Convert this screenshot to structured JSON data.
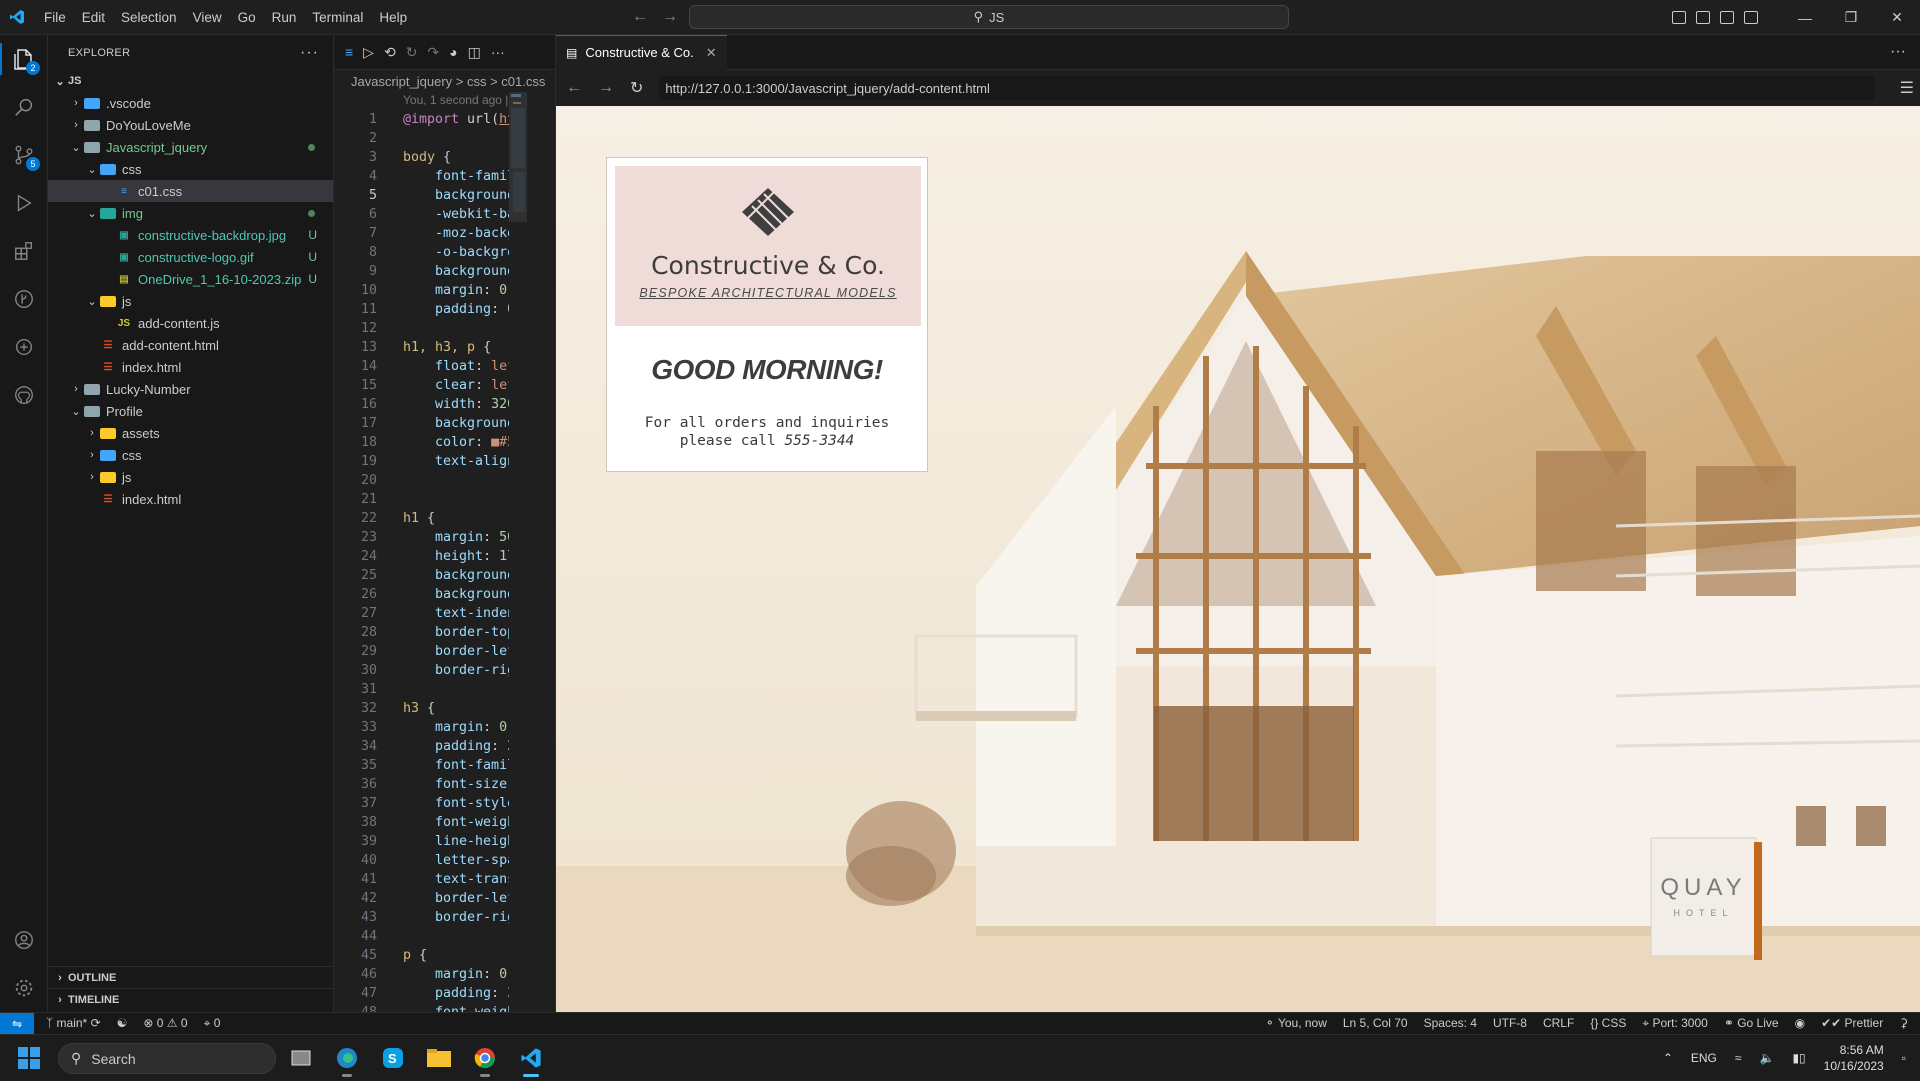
{
  "titlebar": {
    "menu": [
      "File",
      "Edit",
      "Selection",
      "View",
      "Go",
      "Run",
      "Terminal",
      "Help"
    ],
    "search_text": "JS"
  },
  "activity": {
    "explorer_badge": "2",
    "scm_badge": "5"
  },
  "explorer": {
    "title": "EXPLORER",
    "root": "JS",
    "items": [
      {
        "label": ".vscode",
        "depth": 1,
        "type": "folder-blue",
        "open": false
      },
      {
        "label": "DoYouLoveMe",
        "depth": 1,
        "type": "folder",
        "open": false
      },
      {
        "label": "Javascript_jquery",
        "depth": 1,
        "type": "folder",
        "open": true,
        "color": "green",
        "status": "dot"
      },
      {
        "label": "css",
        "depth": 2,
        "type": "folder-blue",
        "open": true
      },
      {
        "label": "c01.css",
        "depth": 3,
        "type": "css",
        "selected": true
      },
      {
        "label": "img",
        "depth": 2,
        "type": "folder-teal",
        "open": true,
        "color": "green",
        "status": "dot"
      },
      {
        "label": "constructive-backdrop.jpg",
        "depth": 3,
        "type": "img",
        "color": "green",
        "status": "U"
      },
      {
        "label": "constructive-logo.gif",
        "depth": 3,
        "type": "img",
        "color": "green",
        "status": "U"
      },
      {
        "label": "OneDrive_1_16-10-2023.zip",
        "depth": 3,
        "type": "zip",
        "color": "green",
        "status": "U"
      },
      {
        "label": "js",
        "depth": 2,
        "type": "folder-yellow",
        "open": true
      },
      {
        "label": "add-content.js",
        "depth": 3,
        "type": "js"
      },
      {
        "label": "add-content.html",
        "depth": 2,
        "type": "html"
      },
      {
        "label": "index.html",
        "depth": 2,
        "type": "html"
      },
      {
        "label": "Lucky-Number",
        "depth": 1,
        "type": "folder",
        "open": false
      },
      {
        "label": "Profile",
        "depth": 1,
        "type": "folder",
        "open": true
      },
      {
        "label": "assets",
        "depth": 2,
        "type": "folder-yellow",
        "open": false
      },
      {
        "label": "css",
        "depth": 2,
        "type": "folder-blue",
        "open": false
      },
      {
        "label": "js",
        "depth": 2,
        "type": "folder-yellow",
        "open": false
      },
      {
        "label": "index.html",
        "depth": 2,
        "type": "html"
      }
    ],
    "outline": "OUTLINE",
    "timeline": "TIMELINE"
  },
  "editor": {
    "breadcrumb": "Javascript_jquery > css > c01.css",
    "blame": "You, 1 second ago | 1",
    "lines": [
      [
        [
          "kw",
          "@import"
        ],
        [
          "pun",
          " url("
        ],
        [
          "url",
          "htt"
        ]
      ],
      [],
      [
        [
          "sel-k",
          "body"
        ],
        [
          "pun",
          " {"
        ]
      ],
      [
        [
          "prop",
          "    font-family"
        ]
      ],
      [
        [
          "prop",
          "    background:"
        ]
      ],
      [
        [
          "prop",
          "    -webkit-bac"
        ]
      ],
      [
        [
          "prop",
          "    -moz-backgr"
        ]
      ],
      [
        [
          "prop",
          "    -o-backgrou"
        ]
      ],
      [
        [
          "prop",
          "    background-"
        ]
      ],
      [
        [
          "prop",
          "    margin"
        ],
        [
          "pun",
          ": "
        ],
        [
          "num",
          "0"
        ],
        [
          "pun",
          ";"
        ]
      ],
      [
        [
          "prop",
          "    padding"
        ],
        [
          "pun",
          ": "
        ],
        [
          "num",
          "0"
        ],
        [
          "pun",
          ";"
        ]
      ],
      [],
      [
        [
          "sel-k",
          "h1, h3, p"
        ],
        [
          "pun",
          " {"
        ]
      ],
      [
        [
          "prop",
          "    float"
        ],
        [
          "pun",
          ": "
        ],
        [
          "val",
          "left"
        ]
      ],
      [
        [
          "prop",
          "    clear"
        ],
        [
          "pun",
          ": "
        ],
        [
          "val",
          "left"
        ]
      ],
      [
        [
          "prop",
          "    width"
        ],
        [
          "pun",
          ": "
        ],
        [
          "num",
          "320p"
        ]
      ],
      [
        [
          "prop",
          "    background-"
        ]
      ],
      [
        [
          "prop",
          "    color"
        ],
        [
          "pun",
          ": "
        ],
        [
          "val",
          "■#5"
        ]
      ],
      [
        [
          "prop",
          "    text-align:"
        ]
      ],
      [],
      [],
      [
        [
          "sel-k",
          "h1"
        ],
        [
          "pun",
          " {"
        ]
      ],
      [
        [
          "prop",
          "    margin"
        ],
        [
          "pun",
          ": "
        ],
        [
          "num",
          "50p"
        ]
      ],
      [
        [
          "prop",
          "    height"
        ],
        [
          "pun",
          ": "
        ],
        [
          "num",
          "175"
        ]
      ],
      [
        [
          "prop",
          "    background-"
        ]
      ],
      [
        [
          "prop",
          "    background-"
        ]
      ],
      [
        [
          "prop",
          "    text-indent"
        ]
      ],
      [
        [
          "prop",
          "    border-top:"
        ]
      ],
      [
        [
          "prop",
          "    border-left"
        ]
      ],
      [
        [
          "prop",
          "    border-righ"
        ]
      ],
      [],
      [
        [
          "sel-k",
          "h3"
        ],
        [
          "pun",
          " {"
        ]
      ],
      [
        [
          "prop",
          "    margin"
        ],
        [
          "pun",
          ": "
        ],
        [
          "num",
          "0 0"
        ]
      ],
      [
        [
          "prop",
          "    padding"
        ],
        [
          "pun",
          ": "
        ],
        [
          "num",
          "25"
        ]
      ],
      [
        [
          "prop",
          "    font-family"
        ]
      ],
      [
        [
          "prop",
          "    font-size:"
        ]
      ],
      [
        [
          "prop",
          "    font-style:"
        ]
      ],
      [
        [
          "prop",
          "    font-weight"
        ]
      ],
      [
        [
          "prop",
          "    line-height"
        ]
      ],
      [
        [
          "prop",
          "    letter-spac"
        ]
      ],
      [
        [
          "prop",
          "    text-transf"
        ]
      ],
      [
        [
          "prop",
          "    border-left"
        ]
      ],
      [
        [
          "prop",
          "    border-righ"
        ]
      ],
      [],
      [
        [
          "sel-k",
          "p"
        ],
        [
          "pun",
          " {"
        ]
      ],
      [
        [
          "prop",
          "    margin"
        ],
        [
          "pun",
          ": "
        ],
        [
          "num",
          "0 0"
        ]
      ],
      [
        [
          "prop",
          "    padding"
        ],
        [
          "pun",
          ": "
        ],
        [
          "num",
          "30"
        ]
      ],
      [
        [
          "prop",
          "    font-weight"
        ]
      ]
    ]
  },
  "browser": {
    "tab_title": "Constructive & Co.",
    "url": "http://127.0.0.1:3000/Javascript_jquery/add-content.html",
    "card": {
      "title": "Constructive & Co.",
      "subtitle": "BESPOKE ARCHITECTURAL MODELS",
      "greeting": "GOOD MORNING!",
      "line1": "For all orders and inquiries",
      "line2": "please call ",
      "phone": "555-3344"
    },
    "sign": {
      "name": "QUAY",
      "sub": "HOTEL"
    }
  },
  "statusbar": {
    "branch": "main*",
    "errors": "0",
    "warnings": "0",
    "ports": "0",
    "blame": "You, now",
    "position": "Ln 5, Col 70",
    "spaces": "Spaces: 4",
    "encoding": "UTF-8",
    "eol": "CRLF",
    "language": "CSS",
    "port": "Port: 3000",
    "golive": "Go Live",
    "prettier": "Prettier"
  },
  "taskbar": {
    "search": "Search",
    "lang": "ENG",
    "time": "8:56 AM",
    "date": "10/16/2023"
  }
}
